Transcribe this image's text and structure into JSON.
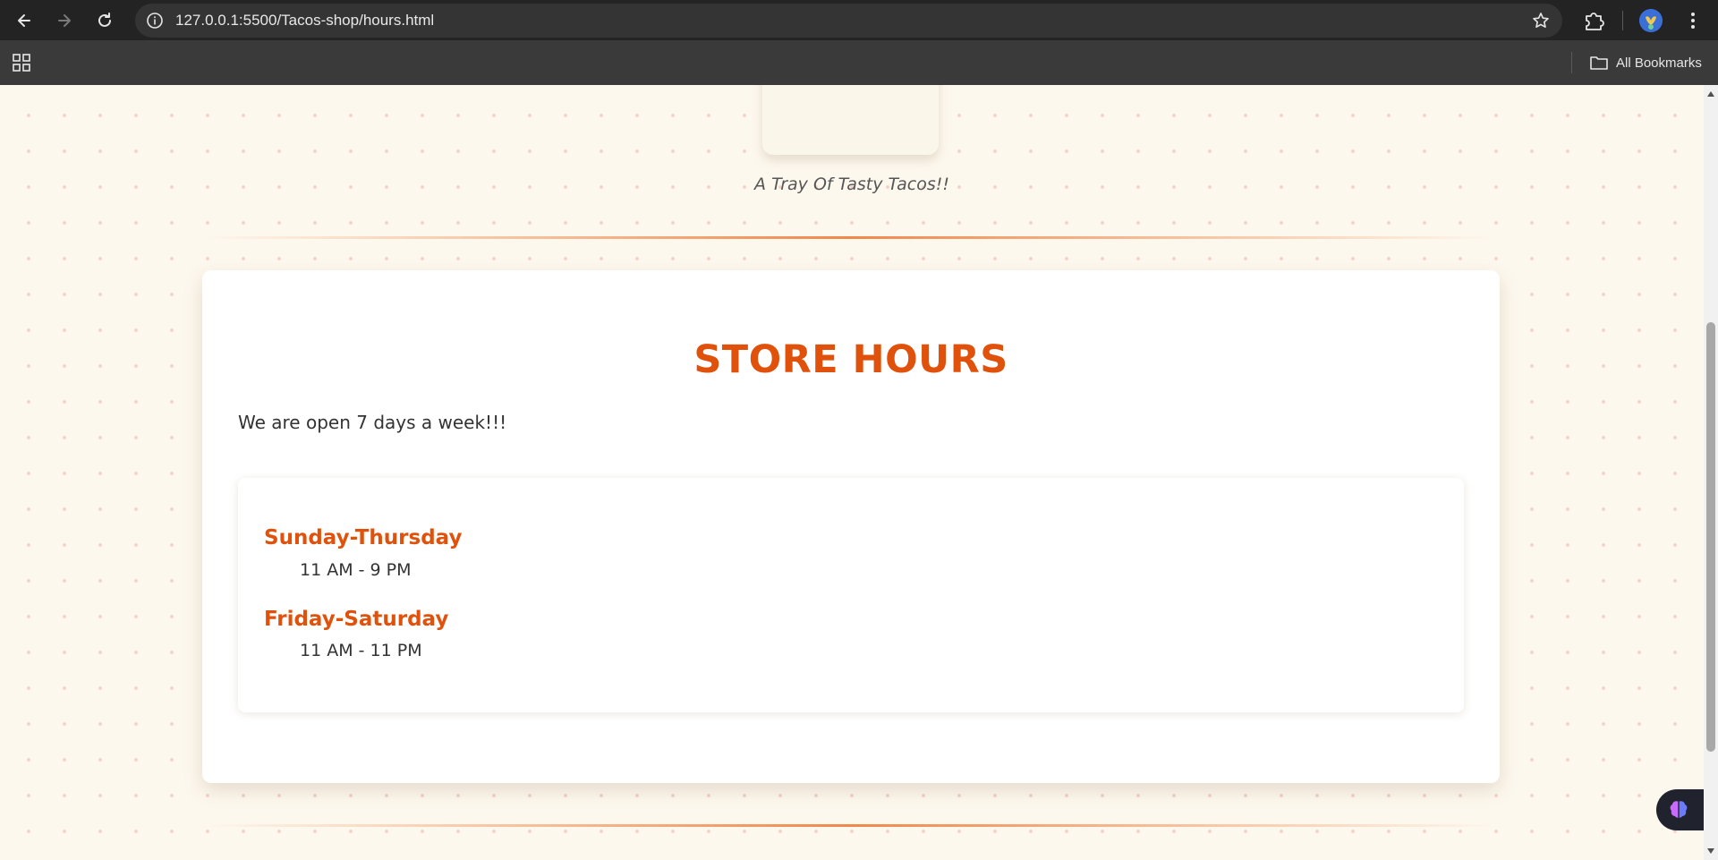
{
  "browser": {
    "url": "127.0.0.1:5500/Tacos-shop/hours.html",
    "bookmarks_label": "All Bookmarks",
    "icons": {
      "back": "back-arrow-icon",
      "forward": "forward-arrow-icon",
      "reload": "reload-icon",
      "site_info": "site-info-icon",
      "bookmark_star": "star-icon",
      "extensions": "puzzle-icon",
      "menu": "kebab-menu-icon",
      "apps": "apps-grid-icon",
      "folder": "folder-icon"
    }
  },
  "page": {
    "image_caption": "A Tray Of Tasty Tacos!!",
    "hours_section": {
      "title": "STORE HOURS",
      "intro": "We are open 7 days a week!!!",
      "schedule": [
        {
          "days": "Sunday-Thursday",
          "hours": "11 AM - 9 PM"
        },
        {
          "days": "Friday-Saturday",
          "hours": "11 AM - 11 PM"
        }
      ]
    }
  },
  "colors": {
    "accent": "#e0520b",
    "page_background": "#fdf8ee",
    "divider": "#f0884a",
    "card_background": "#ffffff"
  }
}
